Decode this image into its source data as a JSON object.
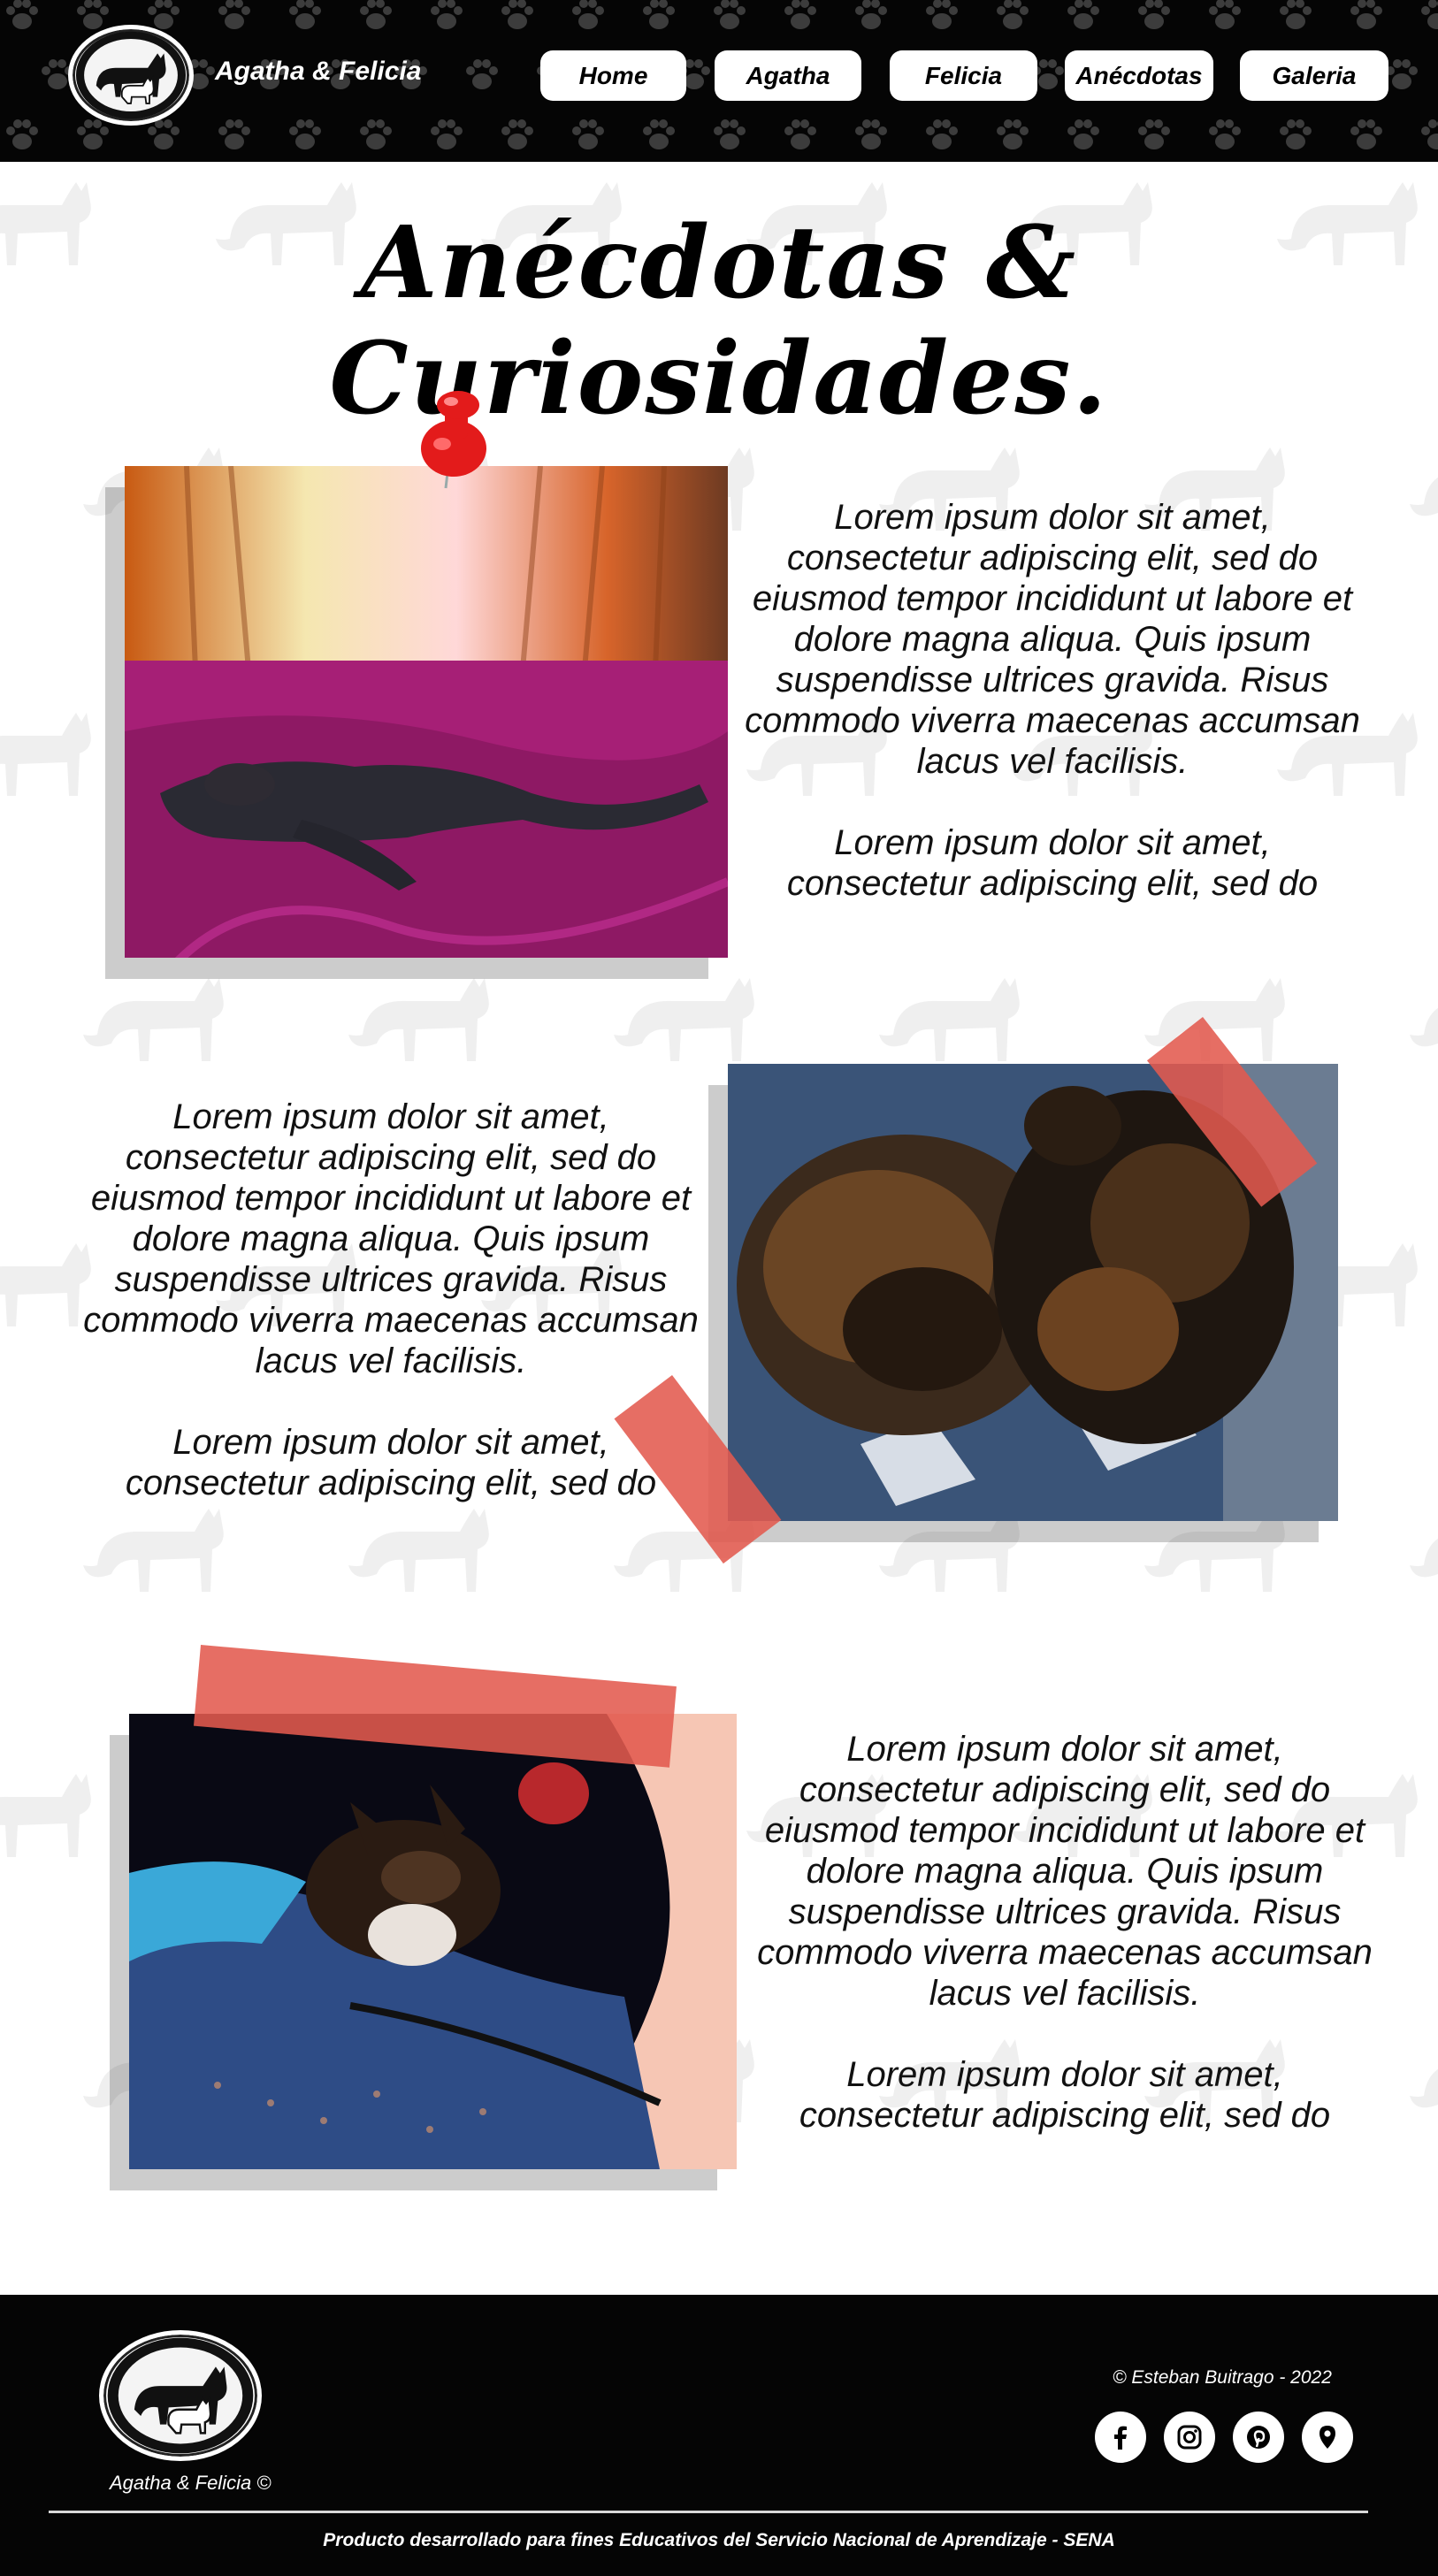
{
  "header": {
    "brand": "Agatha & Felicia",
    "logo_icon": "cat-pair-logo-icon",
    "nav": [
      "Home",
      "Agatha",
      "Felicia",
      "Anécdotas",
      "Galeria"
    ]
  },
  "page_title": "Anécdotas & Curiosidades.",
  "sections": [
    {
      "photo": "tortoiseshell cat stretched on magenta bedspread",
      "paragraphs": [
        "Lorem ipsum dolor sit amet, consectetur adipiscing elit, sed do eiusmod tempor incididunt ut labore et dolore magna aliqua. Quis ipsum suspendisse ultrices gravida. Risus commodo viverra maecenas accumsan lacus vel facilisis.",
        "Lorem ipsum dolor sit amet, consectetur adipiscing elit, sed do"
      ]
    },
    {
      "photo": "two tortoiseshell cats curled up on patterned quilt",
      "paragraphs": [
        "Lorem ipsum dolor sit amet, consectetur adipiscing elit, sed do eiusmod tempor incididunt ut labore et dolore magna aliqua. Quis ipsum suspendisse ultrices gravida. Risus commodo viverra maecenas accumsan lacus vel facilisis.",
        "Lorem ipsum dolor sit amet, consectetur adipiscing elit, sed do"
      ]
    },
    {
      "photo": "kitten sleeping on blue blanket",
      "paragraphs": [
        "Lorem ipsum dolor sit amet, consectetur adipiscing elit, sed do eiusmod tempor incididunt ut labore et dolore magna aliqua. Quis ipsum suspendisse ultrices gravida. Risus commodo viverra maecenas accumsan lacus vel facilisis.",
        "Lorem ipsum dolor sit amet, consectetur adipiscing elit, sed do"
      ]
    }
  ],
  "footer": {
    "brand": "Agatha & Felicia  ©",
    "copyright": "© Esteban Buitrago - 2022",
    "social": [
      "facebook-icon",
      "instagram-icon",
      "pinterest-icon",
      "location-pin-icon"
    ],
    "note": "Producto desarrollado para fines Educativos del Servicio Nacional de Aprendizaje - SENA"
  },
  "colors": {
    "header_bg": "#050505",
    "tape": "#e25a4e",
    "pin": "#e31b1b"
  }
}
